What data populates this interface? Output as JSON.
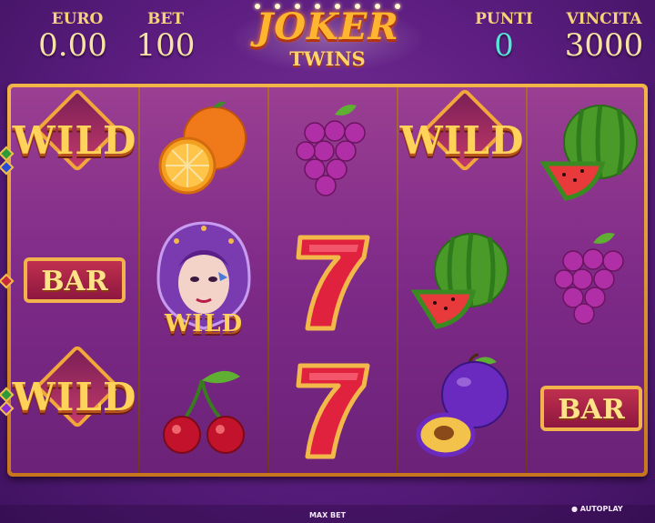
{
  "hud": {
    "euro_label": "EURO",
    "euro_value": "0.00",
    "bet_label": "BET",
    "bet_value": "100",
    "punti_label": "PUNTI",
    "punti_value": "0",
    "vincita_label": "VINCITA",
    "vincita_value": "3000"
  },
  "logo": {
    "line1": "JOKER",
    "line2": "TWINS"
  },
  "reels": [
    [
      "wild",
      "bar",
      "wild"
    ],
    [
      "orange",
      "joker-wild",
      "cherries"
    ],
    [
      "grapes",
      "seven",
      "seven"
    ],
    [
      "wild",
      "watermelon",
      "plum"
    ],
    [
      "watermelon",
      "grapes",
      "bar"
    ]
  ],
  "symbol_text": {
    "wild": "WILD",
    "bar": "BAR",
    "joker_wild": "WILD",
    "seven": "7"
  },
  "footer": {
    "max_bet": "MAX BET",
    "autoplay": "AUTOPLAY"
  },
  "colors": {
    "background": "#5a1d7e",
    "frame_gold": "#f2b548",
    "cyan_value": "#57e4d6",
    "label_gold": "#f6d27a"
  }
}
